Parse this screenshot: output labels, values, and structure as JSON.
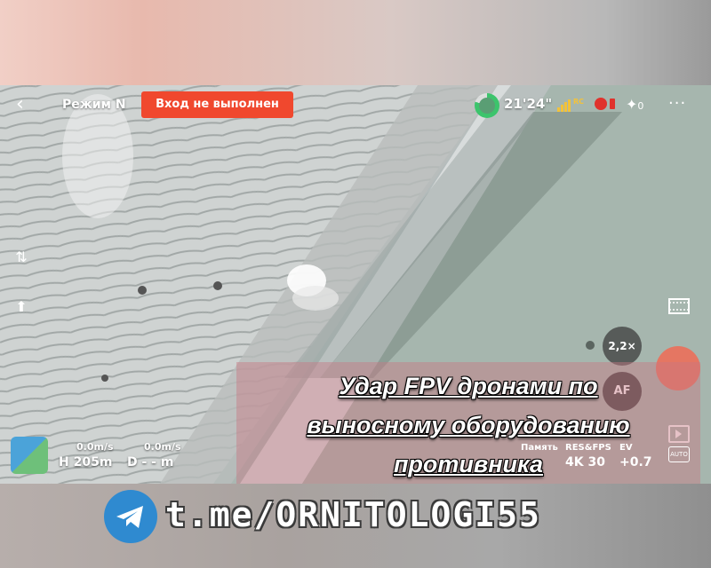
{
  "top_bar": {
    "mode_label": "Режим N",
    "login_status": "Вход не выполнен",
    "flight_time": "21'24\"",
    "rc_label": "RC",
    "gps_count": "0",
    "more_label": "···"
  },
  "right_controls": {
    "zoom_label": "2,2×",
    "af_label": "AF",
    "auto_label": "AUTO"
  },
  "telemetry": {
    "hspeed": "0.0m/s",
    "vspeed": "0.0m/s",
    "height": "H 205m",
    "distance": "D - - m"
  },
  "camera_info": {
    "storage_label": "Память",
    "resfps_label": "RES&FPS",
    "ev_label": "EV",
    "resfps_value": "4K 30",
    "ev_value": "+0.7"
  },
  "caption": {
    "line1": "Удар FPV дронами по",
    "line2": "выносному оборудованию",
    "line3": "противника "
  },
  "channel": {
    "link": "t.me/ORNITOLOGI55"
  },
  "colors": {
    "login_badge": "#f0482e",
    "shutter": "#f06b55",
    "telegram": "#2f8ad0"
  },
  "icons": [
    "back-icon",
    "battery-icon",
    "signal-icon",
    "recording-icon",
    "gps-icon",
    "more-icon",
    "camera-switch-icon",
    "takeoff-icon",
    "film-icon",
    "play-icon",
    "auto-icon",
    "map-icon",
    "telegram-icon"
  ]
}
